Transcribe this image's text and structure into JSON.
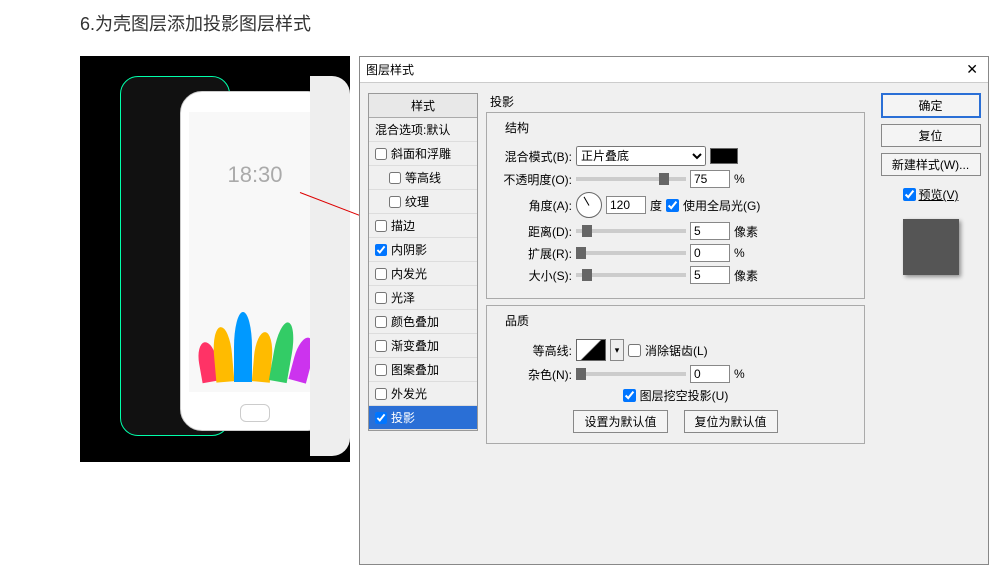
{
  "page": {
    "title": "6.为壳图层添加投影图层样式"
  },
  "dialog": {
    "title": "图层样式"
  },
  "styles": {
    "header": "样式",
    "blend_opts": "混合选项:默认",
    "items": [
      {
        "label": "斜面和浮雕",
        "checked": false,
        "sub": false
      },
      {
        "label": "等高线",
        "checked": false,
        "sub": true
      },
      {
        "label": "纹理",
        "checked": false,
        "sub": true
      },
      {
        "label": "描边",
        "checked": false,
        "sub": false
      },
      {
        "label": "内阴影",
        "checked": true,
        "sub": false
      },
      {
        "label": "内发光",
        "checked": false,
        "sub": false
      },
      {
        "label": "光泽",
        "checked": false,
        "sub": false
      },
      {
        "label": "颜色叠加",
        "checked": false,
        "sub": false
      },
      {
        "label": "渐变叠加",
        "checked": false,
        "sub": false
      },
      {
        "label": "图案叠加",
        "checked": false,
        "sub": false
      },
      {
        "label": "外发光",
        "checked": false,
        "sub": false
      },
      {
        "label": "投影",
        "checked": true,
        "sub": false,
        "selected": true
      }
    ]
  },
  "shadow": {
    "tab": "投影",
    "struct_title": "结构",
    "blend_mode_label": "混合模式(B):",
    "blend_mode_value": "正片叠底",
    "opacity_label": "不透明度(O):",
    "opacity_value": "75",
    "percent": "%",
    "angle_label": "角度(A):",
    "angle_value": "120",
    "angle_unit": "度",
    "global_light": "使用全局光(G)",
    "distance_label": "距离(D):",
    "distance_value": "5",
    "px": "像素",
    "spread_label": "扩展(R):",
    "spread_value": "0",
    "size_label": "大小(S):",
    "size_value": "5",
    "quality_title": "品质",
    "contour_label": "等高线:",
    "antialias": "消除锯齿(L)",
    "noise_label": "杂色(N):",
    "noise_value": "0",
    "knockout": "图层挖空投影(U)",
    "set_default": "设置为默认值",
    "reset_default": "复位为默认值"
  },
  "buttons": {
    "ok": "确定",
    "cancel": "复位",
    "new_style": "新建样式(W)...",
    "preview": "预览(V)"
  }
}
